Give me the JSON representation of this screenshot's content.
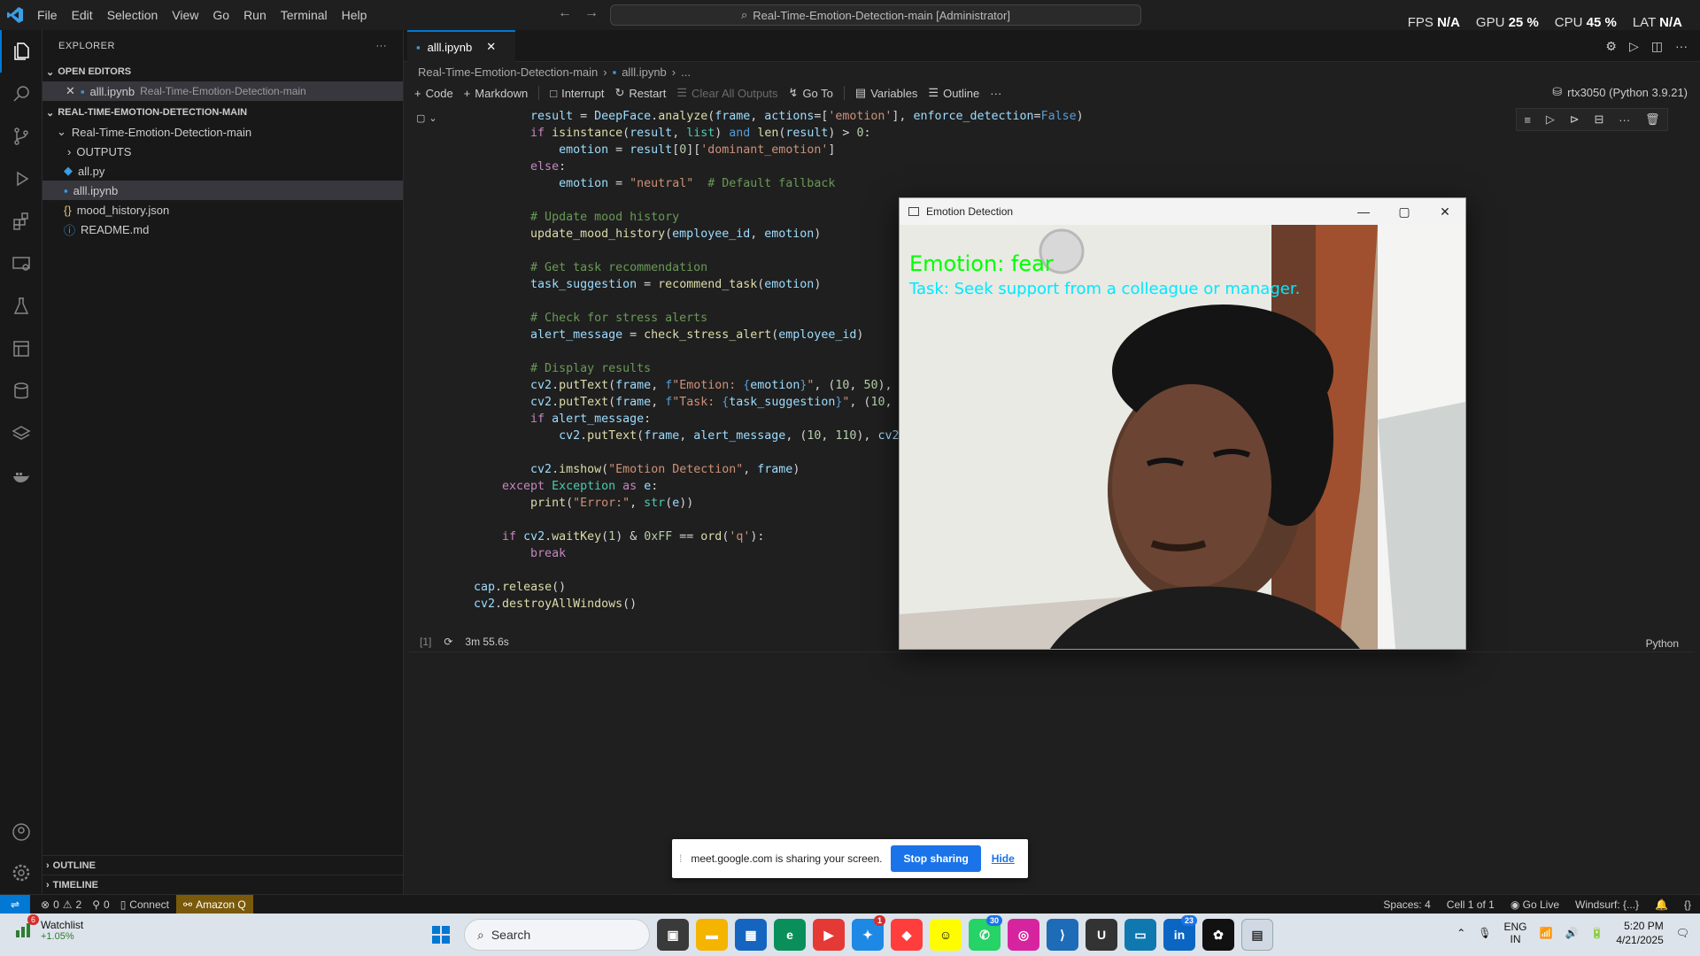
{
  "titlebar": {
    "menu": [
      "File",
      "Edit",
      "Selection",
      "View",
      "Go",
      "Run",
      "Terminal",
      "Help"
    ],
    "search": "Real-Time-Emotion-Detection-main [Administrator]",
    "perf": [
      {
        "label": "FPS",
        "value": "N/A"
      },
      {
        "label": "GPU",
        "value": "25 %"
      },
      {
        "label": "CPU",
        "value": "45 %"
      },
      {
        "label": "LAT",
        "value": "N/A"
      }
    ]
  },
  "sidebar": {
    "title": "EXPLORER",
    "open_editors": "OPEN EDITORS",
    "open_file": "alll.ipynb",
    "open_file_folder": "Real-Time-Emotion-Detection-main",
    "project": "REAL-TIME-EMOTION-DETECTION-MAIN",
    "folder": "Real-Time-Emotion-Detection-main",
    "files": [
      {
        "name": "OUTPUTS",
        "icon": "chevron-right-icon"
      },
      {
        "name": "all.py",
        "icon": "python-file-icon"
      },
      {
        "name": "alll.ipynb",
        "icon": "notebook-file-icon"
      },
      {
        "name": "mood_history.json",
        "icon": "json-file-icon"
      },
      {
        "name": "README.md",
        "icon": "info-icon"
      }
    ],
    "outline": "OUTLINE",
    "timeline": "TIMELINE"
  },
  "editor": {
    "tab": "alll.ipynb",
    "breadcrumb": [
      "Real-Time-Emotion-Detection-main",
      "alll.ipynb",
      "..."
    ],
    "toolbar": [
      "Code",
      "Markdown",
      "Interrupt",
      "Restart",
      "Clear All Outputs",
      "Go To",
      "Variables",
      "Outline"
    ],
    "kernel": "rtx3050 (Python 3.9.21)",
    "exec_count": "[1]",
    "exec_time": "3m 55.6s",
    "language": "Python"
  },
  "emotion_window": {
    "title": "Emotion Detection",
    "emotion_text": "Emotion: fear",
    "task_text": "Task: Seek support from a colleague or manager."
  },
  "share_bar": {
    "message": "meet.google.com is sharing your screen.",
    "stop": "Stop sharing",
    "hide": "Hide"
  },
  "statusbar": {
    "errors": "0",
    "warnings": "2",
    "ports": "0",
    "connect": "Connect",
    "amazon": "Amazon Q",
    "spaces": "Spaces: 4",
    "cell": "Cell 1 of 1",
    "golive": "Go Live",
    "windsurf": "Windsurf: {...}"
  },
  "taskbar": {
    "widget_badge": "6",
    "widget_title": "Watchlist",
    "widget_value": "+1.05%",
    "search": "Search",
    "badges": {
      "copilot": "1",
      "whatsapp": "30",
      "linkedin": "23"
    },
    "lang1": "ENG",
    "lang2": "IN",
    "time": "5:20 PM",
    "date": "4/21/2025"
  },
  "colors": {
    "accent": "#0078d4",
    "emotion": "#00ff00",
    "task": "#00e8ff"
  }
}
